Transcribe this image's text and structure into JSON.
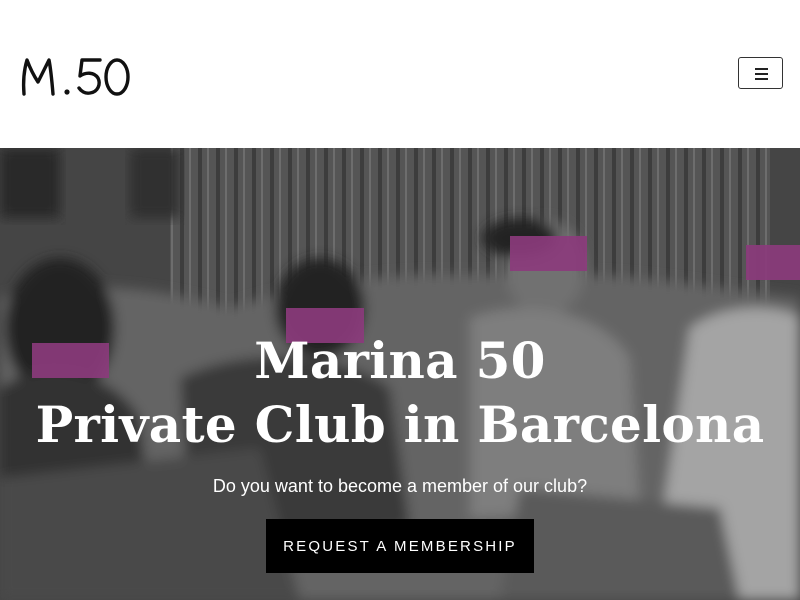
{
  "header": {
    "logo_text": "M.50",
    "menu_icon": "hamburger-menu-icon"
  },
  "hero": {
    "title_line1": "Marina 50",
    "title_line2": "Private Club in Barcelona",
    "subtitle": "Do you want to become a member of our club?",
    "cta_label": "REQUEST A MEMBERSHIP"
  },
  "colors": {
    "accent": "#8b3b7c",
    "cta_background": "#000000",
    "header_background": "#ffffff"
  }
}
